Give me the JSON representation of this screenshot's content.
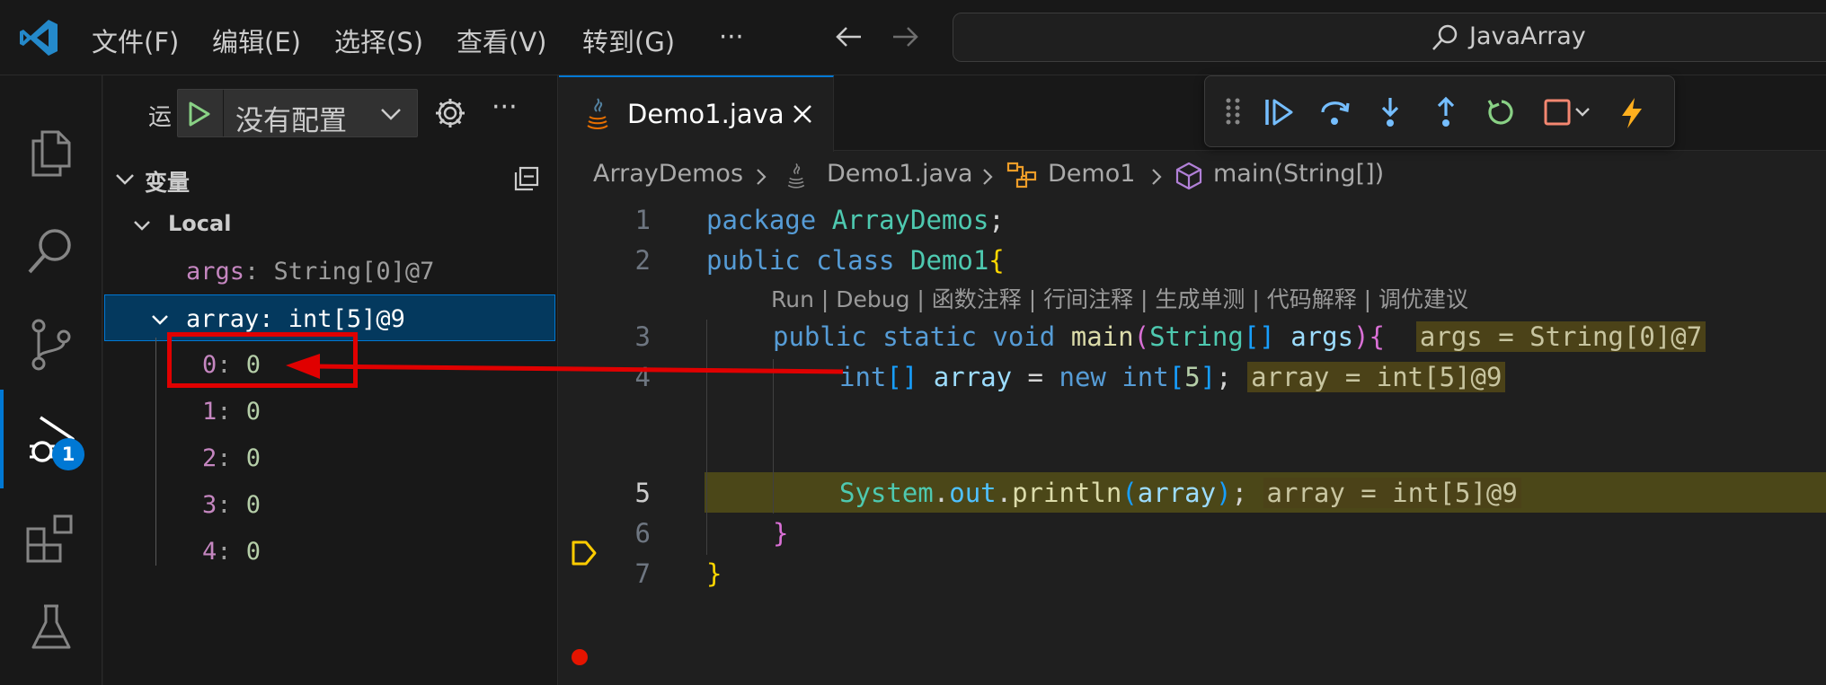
{
  "titlebar": {
    "menu": [
      "文件(F)",
      "编辑(E)",
      "选择(S)",
      "查看(V)",
      "转到(G)",
      "···"
    ],
    "search_text": "JavaArray"
  },
  "activitybar": {
    "items": [
      "explorer-icon",
      "search-icon",
      "source-control-icon",
      "run-debug-icon",
      "extensions-icon",
      "testing-icon"
    ],
    "debug_badge": "1"
  },
  "sidebar": {
    "run_label": "运",
    "config_label": "没有配置",
    "more": "···",
    "variables_title": "变量",
    "scope_label": "Local",
    "vars": [
      {
        "name": "args",
        "sep": ": ",
        "value": "String[0]@7"
      },
      {
        "name": "array",
        "sep": ": ",
        "value": "int[5]@9"
      }
    ],
    "array_items": [
      {
        "name": "0",
        "sep": ": ",
        "value": "0"
      },
      {
        "name": "1",
        "sep": ": ",
        "value": "0"
      },
      {
        "name": "2",
        "sep": ": ",
        "value": "0"
      },
      {
        "name": "3",
        "sep": ": ",
        "value": "0"
      },
      {
        "name": "4",
        "sep": ": ",
        "value": "0"
      }
    ]
  },
  "editor": {
    "tab_label": "Demo1.java",
    "breadcrumb": [
      "ArrayDemos",
      "Demo1.java",
      "Demo1",
      "main(String[])"
    ],
    "codelens": "Run | Debug | 函数注释 | 行间注释 | 生成单测 | 代码解释 | 调优建议",
    "line_numbers": [
      "1",
      "2",
      "3",
      "4",
      "5",
      "6",
      "7"
    ],
    "code": {
      "l1_kw": "package",
      "l1_pkg": "ArrayDemos",
      "l1_end": ";",
      "l2_kw": "public class",
      "l2_cls": "Demo1",
      "l2_br": "{",
      "l3_kw": "public static void",
      "l3_fn": "main",
      "l3_p1": "(",
      "l3_ty": "String",
      "l3_arr": "[]",
      "l3_arg": "args",
      "l3_p2": ")",
      "l3_br": "{",
      "l3_inline": "args = String[0]@7",
      "l4_ty": "int",
      "l4_arr": "[]",
      "l4_var": "array",
      "l4_eq": " = ",
      "l4_new": "new",
      "l4_ty2": "int",
      "l4_br1": "[",
      "l4_num": "5",
      "l4_br2": "]",
      "l4_end": ";",
      "l4_inline": "array = int[5]@9",
      "l5_sys": "System",
      "l5_dot1": ".",
      "l5_out": "out",
      "l5_dot2": ".",
      "l5_fn": "println",
      "l5_p1": "(",
      "l5_arg": "array",
      "l5_p2": ")",
      "l5_end": ";",
      "l5_inline": "array = int[5]@9",
      "l6_br": "}",
      "l7_br": "}"
    }
  },
  "colors": {
    "accent": "#0078d4",
    "annotation": "#e00000",
    "breakpoint": "#e51400",
    "current_line": "#ffcc00"
  }
}
